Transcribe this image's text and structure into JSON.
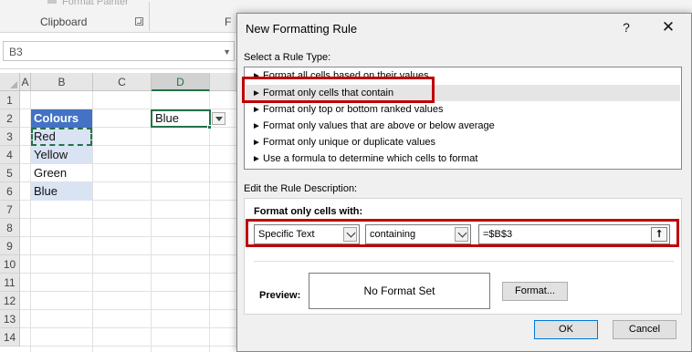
{
  "excel": {
    "ribbon": {
      "faded_text": "Format Painter",
      "clipboard_label": "Clipboard",
      "font_group_partial": "F"
    },
    "name_box": "B3",
    "columns": [
      "A",
      "B",
      "C",
      "D"
    ],
    "rows": [
      "1",
      "2",
      "3",
      "4",
      "5",
      "6",
      "7",
      "8",
      "9",
      "10",
      "11",
      "12",
      "13",
      "14"
    ],
    "cells": {
      "b2": "Colours",
      "b3": "Red",
      "b4": "Yellow",
      "b5": "Green",
      "b6": "Blue",
      "d2": "Blue"
    },
    "colors": {
      "header_fill": "#4472c4",
      "band_fill": "#dae3f3",
      "excel_green": "#217346"
    }
  },
  "dialog": {
    "title": "New Formatting Rule",
    "help_icon": "?",
    "close_icon": "✕",
    "select_type_label": "Select a Rule Type:",
    "rule_types": [
      "Format all cells based on their values",
      "Format only cells that contain",
      "Format only top or bottom ranked values",
      "Format only values that are above or below average",
      "Format only unique or duplicate values",
      "Use a formula to determine which cells to format"
    ],
    "selected_rule_index": 1,
    "edit_desc_label": "Edit the Rule Description:",
    "format_only_label": "Format only cells with:",
    "condition_type": "Specific Text",
    "operator": "containing",
    "reference_value": "=$B$3",
    "preview_label": "Preview:",
    "preview_text": "No Format Set",
    "format_button": "Format...",
    "ok_button": "OK",
    "cancel_button": "Cancel",
    "highlight_color": "#c00000"
  }
}
